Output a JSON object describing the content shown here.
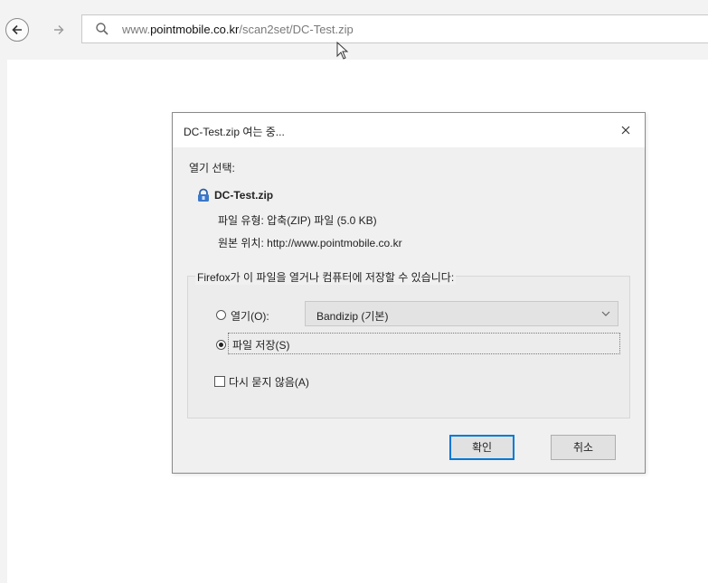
{
  "browser": {
    "url_prefix": "www.",
    "url_domain": "pointmobile.co.kr",
    "url_path": "/scan2set/DC-Test.zip"
  },
  "dialog": {
    "title": "DC-Test.zip 여는 중...",
    "open_with_label": "열기 선택:",
    "file_name": "DC-Test.zip",
    "file_type": "파일 유형: 압축(ZIP) 파일 (5.0 KB)",
    "file_source": "원본 위치: http://www.pointmobile.co.kr",
    "group_caption": "Firefox가 이 파일을 열거나 컴퓨터에 저장할 수 있습니다:",
    "open_option_label": "열기(O):",
    "open_app": "Bandizip (기본)",
    "save_option_label": "파일 저장(S)",
    "dont_ask_label": "다시 묻지 않음(A)",
    "ok_label": "확인",
    "cancel_label": "취소",
    "selected_option": "save"
  }
}
